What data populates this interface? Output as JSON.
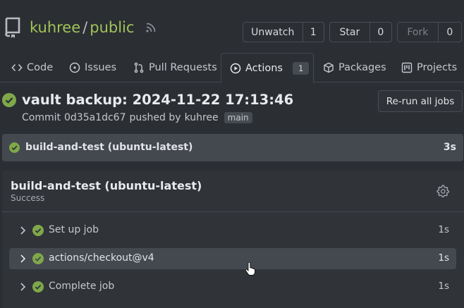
{
  "repo": {
    "owner": "kuhree",
    "separator": "/",
    "name": "public"
  },
  "header_buttons": {
    "watch": {
      "label": "Unwatch",
      "count": "1"
    },
    "star": {
      "label": "Star",
      "count": "0"
    },
    "fork": {
      "label": "Fork",
      "count": "0"
    }
  },
  "tabs": [
    {
      "label": "Code",
      "icon": "code-icon"
    },
    {
      "label": "Issues",
      "icon": "issue-icon"
    },
    {
      "label": "Pull Requests",
      "icon": "pull-request-icon"
    },
    {
      "label": "Actions",
      "icon": "play-icon",
      "badge": "1",
      "active": true
    },
    {
      "label": "Packages",
      "icon": "package-icon"
    },
    {
      "label": "Projects",
      "icon": "project-icon"
    }
  ],
  "run": {
    "title": "vault backup: 2024-11-22 17:13:46",
    "commit_prefix": "Commit",
    "commit_sha": "0d35a1dc67",
    "pushed_by": "pushed by",
    "author": "kuhree",
    "branch": "main",
    "rerun_label": "Re-run all jobs"
  },
  "job_summary": {
    "name": "build-and-test (ubuntu-latest)",
    "duration": "3s"
  },
  "job_detail": {
    "title": "build-and-test (ubuntu-latest)",
    "status": "Success",
    "steps": [
      {
        "name": "Set up job",
        "duration": "1s"
      },
      {
        "name": "actions/checkout@v4",
        "duration": "1s"
      },
      {
        "name": "Complete job",
        "duration": "1s"
      }
    ]
  },
  "colors": {
    "success": "#7fa84a",
    "accent": "#a0c458",
    "background": "#2b2e33"
  }
}
